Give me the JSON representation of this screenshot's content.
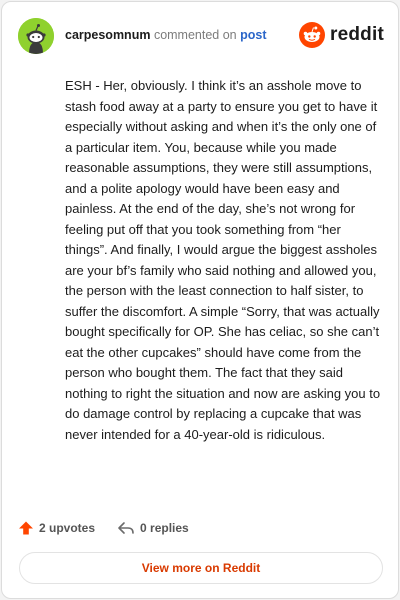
{
  "comment": {
    "username": "carpesomnum",
    "action_text": "commented on",
    "post_link": "post",
    "body": "ESH - Her, obviously. I think it’s an asshole move to stash food away at a party to ensure you get to have it especially without asking and when it’s the only one of a particular item. You, because while you made reasonable assumptions, they were still assumptions, and a polite apology would have been easy and painless. At the end of the day, she’s not wrong for feeling put off that you took something from “her things”. And finally, I would argue the biggest assholes are your bf’s family who said nothing and allowed you, the person with the least connection to half sister, to suffer the discomfort. A simple “Sorry, that was actually bought specifically for OP. She has celiac, so she can’t eat the other cupcakes” should have come from the person who bought them. The fact that they said nothing to right the situation and now are asking you to do damage control by replacing a cupcake that was never intended for a 40-year-old is ridiculous.",
    "upvotes": "2 upvotes",
    "replies": "0 replies"
  },
  "brand": {
    "name": "reddit",
    "icon": "reddit-snoo-icon",
    "color": "#ff4500"
  },
  "avatar": {
    "color": "#8fd12e",
    "icon": "snoo-avatar"
  },
  "cta": {
    "label": "View more on Reddit",
    "color": "#d93a00"
  },
  "icons": {
    "upvote": "upvote-arrow-icon",
    "reply": "reply-arrow-icon"
  },
  "colors": {
    "link": "#2b66c9",
    "upvote": "#ff4500"
  }
}
